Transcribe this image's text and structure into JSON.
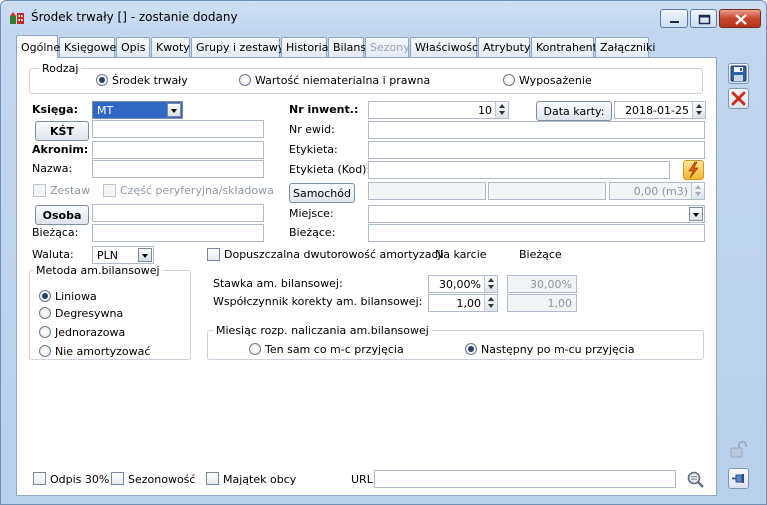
{
  "window": {
    "title": "Środek trwały [] - zostanie dodany"
  },
  "tabs": [
    {
      "label": "Ogólne",
      "active": true
    },
    {
      "label": "Księgowe"
    },
    {
      "label": "Opis"
    },
    {
      "label": "Kwoty"
    },
    {
      "label": "Grupy i zestawy"
    },
    {
      "label": "Historia"
    },
    {
      "label": "Bilans"
    },
    {
      "label": "Sezony",
      "disabled": true
    },
    {
      "label": "Właściwości"
    },
    {
      "label": "Atrybuty"
    },
    {
      "label": "Kontrahent"
    },
    {
      "label": "Załączniki"
    }
  ],
  "rodzaj": {
    "title": "Rodzaj",
    "options": [
      "Środek trwały",
      "Wartość niematerialna i prawna",
      "Wyposażenie"
    ],
    "selected": 0
  },
  "left": {
    "ksiega_label": "Księga:",
    "ksiega_value": "MT",
    "kst_button": "KŚT",
    "akronim_label": "Akronim:",
    "nazwa_label": "Nazwa:",
    "zestaw_label": "Zestaw",
    "czesc_label": "Część peryferyjna/składowa",
    "osoba_button": "Osoba",
    "biezaca_label": "Bieżąca:",
    "waluta_label": "Waluta:",
    "waluta_value": "PLN"
  },
  "right": {
    "nr_inwent_label": "Nr inwent.:",
    "nr_inwent_value": "10",
    "data_karty_button": "Data karty:",
    "data_karty_value": "2018-01-25",
    "nr_ewid_label": "Nr ewid:",
    "etykieta_label": "Etykieta:",
    "etykieta_kod_label": "Etykieta (Kod):",
    "samochod_button": "Samochód",
    "samochod_value": "0,00 (m3)",
    "miejsce_label": "Miejsce:",
    "biezace_label": "Bieżące:"
  },
  "metoda": {
    "title": "Metoda am.bilansowej",
    "options": [
      "Liniowa",
      "Degresywna",
      "Jednorazowa",
      "Nie amortyzować"
    ],
    "selected": 0
  },
  "amort": {
    "dwutorowosc_label": "Dopuszczalna dwutorowość amortyzacji",
    "na_karcie_header": "Na karcie",
    "biezace_header": "Bieżące",
    "stawka_label": "Stawka am. bilansowej:",
    "stawka_karta": "30,00%",
    "stawka_biezaca": "30,00%",
    "wsp_label": "Współczynnik korekty am. bilansowej:",
    "wsp_karta": "1,00",
    "wsp_biezacy": "1,00"
  },
  "miesiac": {
    "title": "Miesiąc rozp. naliczania am.bilansowej",
    "options": [
      "Ten sam co m-c przyjęcia",
      "Następny po m-cu przyjęcia"
    ],
    "selected": 1
  },
  "bottom": {
    "odpis_label": "Odpis 30%",
    "sezonowosc_label": "Sezonowość",
    "majatek_label": "Majątek obcy",
    "url_label": "URL:"
  },
  "colors": {
    "window_bg": "#c2d6ee",
    "close_button": "#c7452c",
    "save_icon": "#2f5fa8",
    "delete_icon": "#d0281a"
  }
}
